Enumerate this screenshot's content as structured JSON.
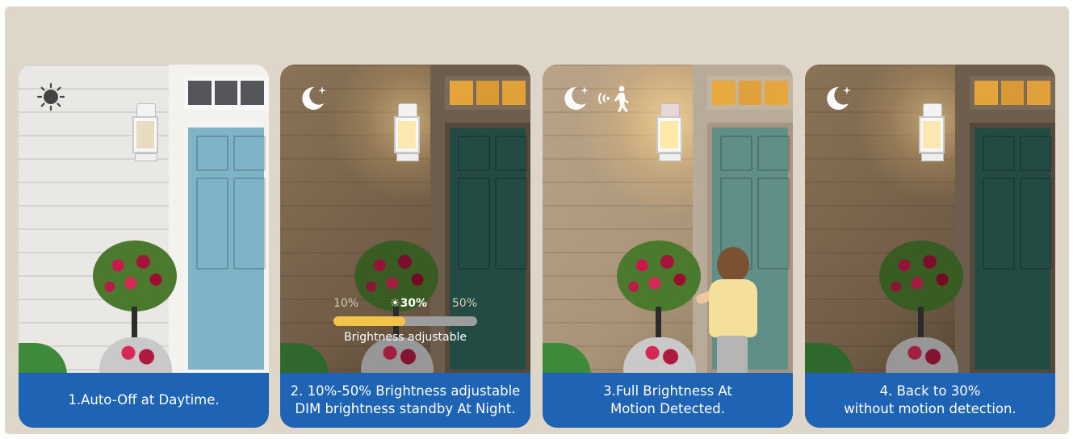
{
  "panels": [
    {
      "caption": [
        "1.Auto-Off at Daytime."
      ],
      "icons": [
        "sun-icon"
      ]
    },
    {
      "caption": [
        "2. 10%-50% Brightness adjustable",
        "DIM brightness standby At Night."
      ],
      "icons": [
        "moon-icon"
      ],
      "brightness": {
        "min_label": "10%",
        "current_label": "30%",
        "max_label": "50%",
        "caption": "Brightness adjustable",
        "level_percent": 30,
        "range_percent": [
          10,
          50
        ]
      }
    },
    {
      "caption": [
        "3.Full Brightness At",
        "Motion Detected."
      ],
      "icons": [
        "moon-icon",
        "motion-sensor-icon"
      ]
    },
    {
      "caption": [
        "4. Back to 30%",
        "without motion detection."
      ],
      "icons": [
        "moon-icon"
      ]
    }
  ],
  "colors": {
    "caption_bar": "#1f63b4",
    "brightness_fill": "#f4c34a",
    "frame_background": "#ddd6c9"
  }
}
